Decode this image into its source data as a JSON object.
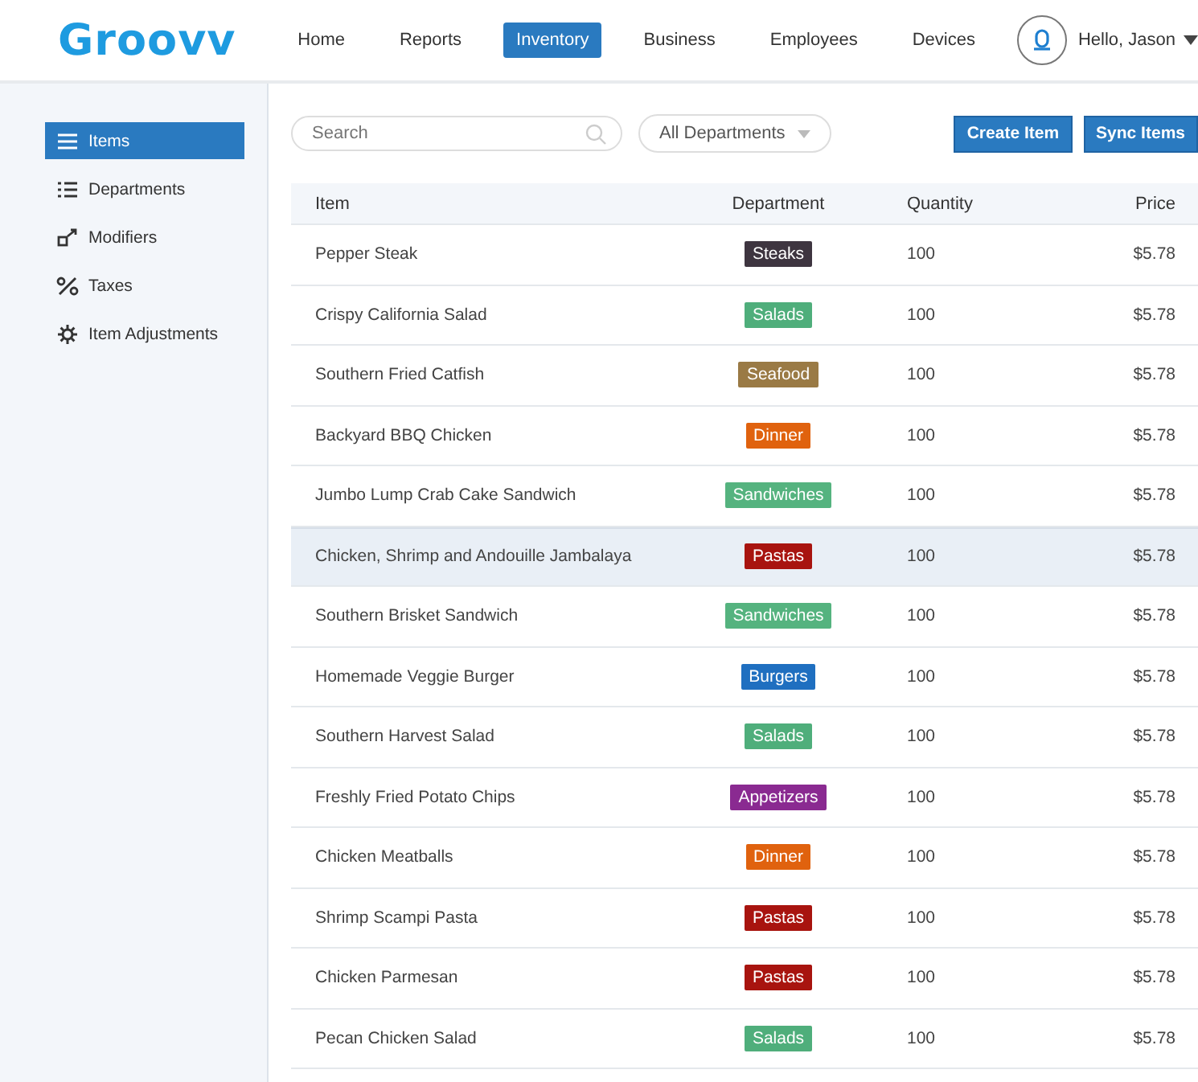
{
  "logo": "Groovv",
  "nav": [
    {
      "label": "Home",
      "selected": false
    },
    {
      "label": "Reports",
      "selected": false
    },
    {
      "label": "Inventory",
      "selected": true
    },
    {
      "label": "Business",
      "selected": false
    },
    {
      "label": "Employees",
      "selected": false
    },
    {
      "label": "Devices",
      "selected": false
    }
  ],
  "user": {
    "greeting": "Hello, Jason"
  },
  "sidebar": {
    "items": [
      {
        "label": "Items",
        "selected": true
      },
      {
        "label": "Departments",
        "selected": false
      },
      {
        "label": "Modifiers",
        "selected": false
      },
      {
        "label": "Taxes",
        "selected": false
      },
      {
        "label": "Item Adjustments",
        "selected": false
      }
    ]
  },
  "toolbar": {
    "search": {
      "placeholder": "Search"
    },
    "filter": "All Departments",
    "buttons": [
      "Create Item",
      "Sync Items"
    ]
  },
  "table": {
    "columns": [
      "Item",
      "Department",
      "Quantity",
      "Price"
    ],
    "rows": [
      {
        "item": "Pepper Steak",
        "department": "Steaks",
        "color": "#3e3540",
        "quantity": "100",
        "price": "$5.78",
        "highlighted": false
      },
      {
        "item": "Crispy California Salad",
        "department": "Salads",
        "color": "#4fae7b",
        "quantity": "100",
        "price": "$5.78",
        "highlighted": false
      },
      {
        "item": "Southern Fried Catfish",
        "department": "Seafood",
        "color": "#9a7a45",
        "quantity": "100",
        "price": "$5.78",
        "highlighted": false
      },
      {
        "item": "Backyard BBQ Chicken",
        "department": "Dinner",
        "color": "#e0620e",
        "quantity": "100",
        "price": "$5.78",
        "highlighted": false
      },
      {
        "item": "Jumbo Lump Crab Cake Sandwich",
        "department": "Sandwiches",
        "color": "#55b37f",
        "quantity": "100",
        "price": "$5.78",
        "highlighted": false
      },
      {
        "item": "Chicken, Shrimp and Andouille Jambalaya",
        "department": "Pastas",
        "color": "#a8140f",
        "quantity": "100",
        "price": "$5.78",
        "highlighted": true
      },
      {
        "item": "Southern Brisket Sandwich",
        "department": "Sandwiches",
        "color": "#55b37f",
        "quantity": "100",
        "price": "$5.78",
        "highlighted": false
      },
      {
        "item": "Homemade Veggie Burger",
        "department": "Burgers",
        "color": "#1f6fc0",
        "quantity": "100",
        "price": "$5.78",
        "highlighted": false
      },
      {
        "item": "Southern Harvest Salad",
        "department": "Salads",
        "color": "#4fae7b",
        "quantity": "100",
        "price": "$5.78",
        "highlighted": false
      },
      {
        "item": "Freshly Fried Potato Chips",
        "department": "Appetizers",
        "color": "#8a2a91",
        "quantity": "100",
        "price": "$5.78",
        "highlighted": false
      },
      {
        "item": "Chicken Meatballs",
        "department": "Dinner",
        "color": "#e0620e",
        "quantity": "100",
        "price": "$5.78",
        "highlighted": false
      },
      {
        "item": "Shrimp Scampi Pasta",
        "department": "Pastas",
        "color": "#a8140f",
        "quantity": "100",
        "price": "$5.78",
        "highlighted": false
      },
      {
        "item": "Chicken Parmesan",
        "department": "Pastas",
        "color": "#a8140f",
        "quantity": "100",
        "price": "$5.78",
        "highlighted": false
      },
      {
        "item": "Pecan Chicken Salad",
        "department": "Salads",
        "color": "#4fae7b",
        "quantity": "100",
        "price": "$5.78",
        "highlighted": false
      }
    ]
  }
}
